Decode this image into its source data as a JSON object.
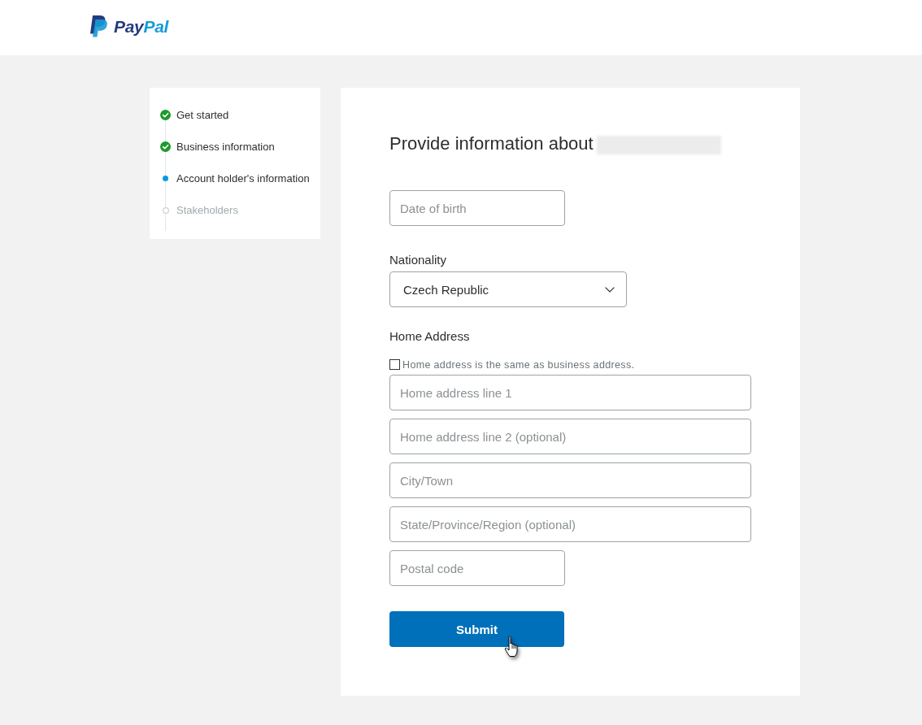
{
  "logo": {
    "parts": [
      {
        "text": "Pay",
        "color": "#253b80"
      },
      {
        "text": "Pal",
        "color": "#179bd7"
      }
    ]
  },
  "steps": [
    {
      "label": "Get started",
      "completed": true,
      "current": false
    },
    {
      "label": "Business information",
      "completed": true,
      "current": false
    },
    {
      "label": "Account holder's information",
      "completed": false,
      "current": true
    },
    {
      "label": "Stakeholders",
      "completed": false,
      "current": false
    }
  ],
  "form": {
    "heading": "Provide information about",
    "date_of_birth": {
      "placeholder": "Date of birth"
    },
    "nationality": {
      "label": "Nationality",
      "value": "Czech Republic"
    },
    "home_address": {
      "label": "Home Address",
      "same_as_business": {
        "label": "Home address is the same as business address.",
        "checked": false
      },
      "fields": [
        {
          "placeholder": "Home address line 1",
          "kind": "wide"
        },
        {
          "placeholder": "Home address line 2 (optional)",
          "kind": "wide"
        },
        {
          "placeholder": "City/Town",
          "kind": "wide"
        },
        {
          "placeholder": "State/Province/Region (optional)",
          "kind": "wide"
        },
        {
          "placeholder": "Postal code",
          "kind": "narrow"
        }
      ]
    },
    "submit": "Submit"
  }
}
